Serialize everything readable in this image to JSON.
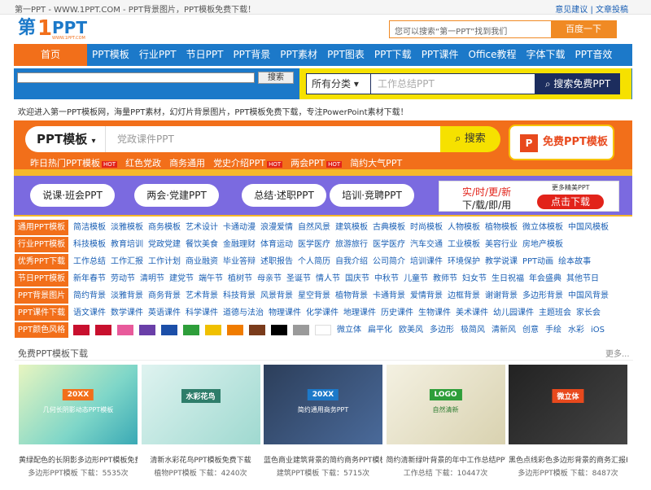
{
  "topbar": {
    "site": "第一PPT - WWW.1PPT.COM - PPT背景图片，PPT模板免费下载！",
    "feedback": "意见建议",
    "sep": "|",
    "submit": "文章投稿"
  },
  "logo": {
    "text": "第1PPT",
    "url_text": "WWW.1PPT.COM"
  },
  "header_search": {
    "placeholder": "您可以搜索“第一PPT”找到我们",
    "button": "百度一下"
  },
  "nav": {
    "home": "首页",
    "items": [
      "PPT模板",
      "行业PPT",
      "节日PPT",
      "PPT背景",
      "PPT素材",
      "PPT图表",
      "PPT下载",
      "PPT课件",
      "Office教程",
      "字体下载",
      "PPT音效"
    ]
  },
  "site_search": {
    "button": "搜索"
  },
  "main_search": {
    "category": "所有分类",
    "placeholder": "工作总结PPT",
    "button": "搜索免费PPT"
  },
  "welcome": "欢迎进入第一PPT模板网，海量PPT素材，幻灯片背景图片，PPT模板免费下载，专注PowerPoint素材下载！",
  "banner": {
    "select": "PPT模板",
    "placeholder": "党政课件PPT",
    "search": "搜索",
    "free": "免费PPT模板",
    "hot": [
      {
        "t": "昨日热门PPT模板",
        "hot": "HOT"
      },
      {
        "t": "红色党政"
      },
      {
        "t": "商务通用"
      },
      {
        "t": "党史介绍PPT",
        "hot": "HOT"
      },
      {
        "t": "两会PPT",
        "hot": "HOT"
      },
      {
        "t": "简约大气PPT"
      }
    ],
    "pills": [
      "说课·班会PPT",
      "两会·党建PPT",
      "总结·述职PPT",
      "培训·竞聘PPT"
    ],
    "dl": {
      "line1": "实/时/更/新",
      "line2": "下/载/即/用",
      "more": "更多精美PPT",
      "btn": "点击下载"
    }
  },
  "categories": [
    {
      "label": "通用PPT模板",
      "links": [
        "简洁模板",
        "淡雅模板",
        "商务模板",
        "艺术设计",
        "卡通动漫",
        "浪漫爱情",
        "自然风景",
        "建筑模板",
        "古典模板",
        "时尚模板",
        "人物模板",
        "植物模板",
        "微立体模板",
        "中国风模板"
      ]
    },
    {
      "label": "行业PPT模板",
      "links": [
        "科技模板",
        "教育培训",
        "党政党建",
        "餐饮美食",
        "金融理财",
        "体育运动",
        "医学医疗",
        "旅游旅行",
        "医学医疗",
        "汽车交通",
        "工业模板",
        "美容行业",
        "房地产模板"
      ]
    },
    {
      "label": "优秀PPT下载",
      "links": [
        "工作总结",
        "工作汇报",
        "工作计划",
        "商业融资",
        "毕业答辩",
        "述职报告",
        "个人简历",
        "自我介绍",
        "公司简介",
        "培训课件",
        "环境保护",
        "教学说课",
        "PPT动画",
        "绘本故事"
      ]
    },
    {
      "label": "节日PPT模板",
      "links": [
        "新年春节",
        "劳动节",
        "清明节",
        "建党节",
        "端午节",
        "植树节",
        "母亲节",
        "圣诞节",
        "情人节",
        "国庆节",
        "中秋节",
        "儿童节",
        "教师节",
        "妇女节",
        "生日祝福",
        "年会盛典",
        "其他节日"
      ]
    },
    {
      "label": "PPT背景图片",
      "links": [
        "简约背景",
        "淡雅背景",
        "商务背景",
        "艺术背景",
        "科技背景",
        "风景背景",
        "星空背景",
        "植物背景",
        "卡通背景",
        "爱情背景",
        "边框背景",
        "谢谢背景",
        "多边形背景",
        "中国风背景"
      ]
    },
    {
      "label": "PPT课件下载",
      "links": [
        "语文课件",
        "数学课件",
        "英语课件",
        "科学课件",
        "道德与法治",
        "物理课件",
        "化学课件",
        "地理课件",
        "历史课件",
        "生物课件",
        "美术课件",
        "幼儿园课件",
        "主题班会",
        "家长会"
      ]
    },
    {
      "label": "PPT颜色风格",
      "links": [
        "微立体",
        "扁平化",
        "欧美风",
        "多边形",
        "极简风",
        "清新风",
        "创意",
        "手绘",
        "水彩",
        "iOS"
      ]
    }
  ],
  "swatches": [
    "#c8102e",
    "#c8102e",
    "#e85a9b",
    "#6a3fa8",
    "#1c4fa8",
    "#2e9e3a",
    "#f0c000",
    "#f07c00",
    "#7a3b1b",
    "#000000",
    "#9a9a9a",
    "#ffffff"
  ],
  "section": {
    "title": "免费PPT模板下载",
    "more": "更多..."
  },
  "cards": [
    {
      "caption": "黄绿配色的长阴影多边形PPT模板免费下载",
      "cat": "多边形PPT模板",
      "dl": "下载：5535次",
      "badge": "20XX",
      "sub": "几何长阴影动态PPT模板"
    },
    {
      "caption": "清新水彩花鸟PPT模板免费下载",
      "cat": "植物PPT模板",
      "dl": "下载：4240次",
      "badge": "水彩花鸟"
    },
    {
      "caption": "蓝色商业建筑背景的简约商务PPT模板",
      "cat": "建筑PPT模板",
      "dl": "下载：5715次",
      "badge": "20XX",
      "sub": "简约通用商务PPT"
    },
    {
      "caption": "简约清新绿叶背景的年中工作总结PPT模板",
      "cat": "工作总结",
      "dl": "下载：10447次",
      "badge": "LOGO",
      "sub": "自然清新"
    },
    {
      "caption": "黑色点线彩色多边形背景的商务汇报PPT",
      "cat": "多边形PPT模板",
      "dl": "下载：8487次",
      "badge": "微立体"
    }
  ]
}
